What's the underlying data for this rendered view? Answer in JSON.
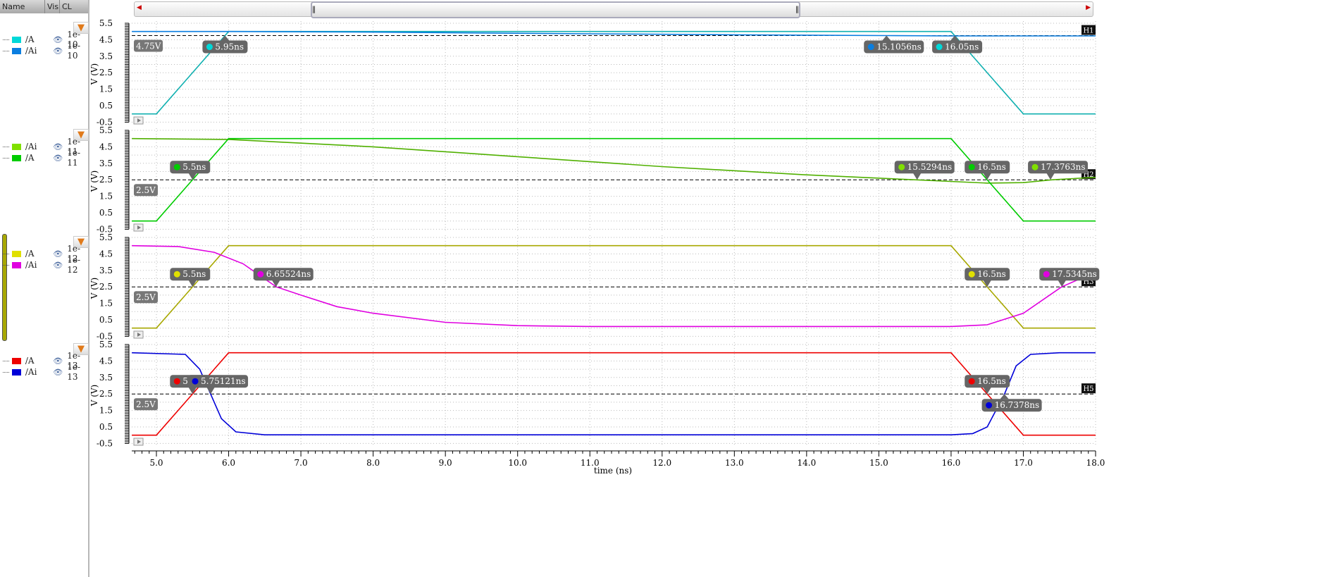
{
  "panel": {
    "headers": {
      "name": "Name",
      "vis": "Vis",
      "cl": "CL"
    },
    "groups": [
      {
        "items": [
          {
            "name": "/A",
            "color": "#00d8d8",
            "cl": "1e-10"
          },
          {
            "name": "/Ai",
            "color": "#0a7ee0",
            "cl": "1e-10"
          }
        ]
      },
      {
        "items": [
          {
            "name": "/Ai",
            "color": "#80e000",
            "cl": "1e-11"
          },
          {
            "name": "/A",
            "color": "#00cc00",
            "cl": "1e-11"
          }
        ]
      },
      {
        "items": [
          {
            "name": "/A",
            "color": "#e0e000",
            "cl": "1e-12"
          },
          {
            "name": "/Ai",
            "color": "#e000e0",
            "cl": "1e-12"
          }
        ]
      },
      {
        "items": [
          {
            "name": "/A",
            "color": "#ee0000",
            "cl": "1e-13"
          },
          {
            "name": "/Ai",
            "color": "#0000d8",
            "cl": "1e-13"
          }
        ]
      }
    ]
  },
  "chart_data": {
    "type": "line",
    "xlabel": "time (ns)",
    "ylabel": "V (V)",
    "xlim": [
      4.66,
      18.0
    ],
    "ylim": [
      -0.5,
      5.5
    ],
    "xticks": [
      "5.0",
      "6.0",
      "7.0",
      "8.0",
      "9.0",
      "10.0",
      "11.0",
      "12.0",
      "13.0",
      "14.0",
      "15.0",
      "16.0",
      "17.0",
      "18.0"
    ],
    "yticks": [
      "5.5",
      "4.5",
      "3.5",
      "2.5",
      "1.5",
      "0.5",
      "-0.5"
    ],
    "grid": true,
    "strips": [
      {
        "series": [
          {
            "name": "/A",
            "color": "#10b0b0",
            "points": [
              [
                4.66,
                0
              ],
              [
                5,
                0
              ],
              [
                6,
                5
              ],
              [
                16,
                5
              ],
              [
                17,
                0
              ],
              [
                18,
                0
              ]
            ]
          },
          {
            "name": "/Ai",
            "color": "#0a7ee0",
            "points": [
              [
                4.66,
                5.0
              ],
              [
                6,
                5.0
              ],
              [
                8,
                4.96
              ],
              [
                11,
                4.86
              ],
              [
                13,
                4.8
              ],
              [
                15.1,
                4.75
              ],
              [
                16,
                4.73
              ],
              [
                18,
                4.73
              ]
            ]
          }
        ],
        "hline": {
          "value": 4.75,
          "label": "4.75V",
          "tag": "H1"
        },
        "markers": [
          {
            "t": 5.95,
            "v": 4.75,
            "label": "5.95ns",
            "color": "#00d8d8",
            "pos": "below"
          },
          {
            "t": 15.1056,
            "v": 4.75,
            "label": "15.1056ns",
            "color": "#0a7ee0",
            "pos": "below"
          },
          {
            "t": 16.05,
            "v": 4.75,
            "label": "16.05ns",
            "color": "#00d8d8",
            "pos": "below"
          }
        ]
      },
      {
        "series": [
          {
            "name": "/Ai",
            "color": "#50b000",
            "points": [
              [
                4.66,
                5
              ],
              [
                6,
                4.95
              ],
              [
                8,
                4.5
              ],
              [
                10,
                3.9
              ],
              [
                12,
                3.3
              ],
              [
                14,
                2.8
              ],
              [
                15.5,
                2.5
              ],
              [
                16.5,
                2.3
              ],
              [
                17,
                2.33
              ],
              [
                17.4,
                2.5
              ],
              [
                18,
                2.65
              ]
            ]
          },
          {
            "name": "/A",
            "color": "#00cc00",
            "points": [
              [
                4.66,
                0
              ],
              [
                5,
                0
              ],
              [
                6,
                5
              ],
              [
                16,
                5
              ],
              [
                17,
                0
              ],
              [
                18,
                0
              ]
            ]
          }
        ],
        "hline": {
          "value": 2.5,
          "label": "2.5V",
          "tag": "H2"
        },
        "markers": [
          {
            "t": 5.5,
            "v": 2.5,
            "label": "5.5ns",
            "color": "#00cc00",
            "pos": "above"
          },
          {
            "t": 15.5294,
            "v": 2.5,
            "label": "15.5294ns",
            "color": "#80e000",
            "pos": "above"
          },
          {
            "t": 16.5,
            "v": 2.5,
            "label": "16.5ns",
            "color": "#00cc00",
            "pos": "above"
          },
          {
            "t": 17.3763,
            "v": 2.5,
            "label": "17.3763ns",
            "color": "#80e000",
            "pos": "above"
          }
        ]
      },
      {
        "series": [
          {
            "name": "/A",
            "color": "#a8a800",
            "points": [
              [
                4.66,
                0
              ],
              [
                5,
                0
              ],
              [
                6,
                5
              ],
              [
                16,
                5
              ],
              [
                17,
                0
              ],
              [
                18,
                0
              ]
            ]
          },
          {
            "name": "/Ai",
            "color": "#e000e0",
            "points": [
              [
                4.66,
                5
              ],
              [
                5.3,
                4.95
              ],
              [
                5.8,
                4.6
              ],
              [
                6.2,
                3.9
              ],
              [
                6.66,
                2.5
              ],
              [
                7,
                2.0
              ],
              [
                7.5,
                1.3
              ],
              [
                8,
                0.9
              ],
              [
                9,
                0.35
              ],
              [
                10,
                0.15
              ],
              [
                11,
                0.1
              ],
              [
                16,
                0.1
              ],
              [
                16.5,
                0.2
              ],
              [
                17,
                0.9
              ],
              [
                17.53,
                2.5
              ],
              [
                18,
                3.4
              ]
            ]
          }
        ],
        "hline": {
          "value": 2.5,
          "label": "2.5V",
          "tag": "H3"
        },
        "markers": [
          {
            "t": 5.5,
            "v": 2.5,
            "label": "5.5ns",
            "color": "#e0e000",
            "pos": "above"
          },
          {
            "t": 6.65524,
            "v": 2.5,
            "label": "6.65524ns",
            "color": "#e000e0",
            "pos": "above"
          },
          {
            "t": 16.5,
            "v": 2.5,
            "label": "16.5ns",
            "color": "#e0e000",
            "pos": "above"
          },
          {
            "t": 17.5345,
            "v": 2.5,
            "label": "17.5345ns",
            "color": "#e000e0",
            "pos": "above"
          }
        ]
      },
      {
        "series": [
          {
            "name": "/A",
            "color": "#ee0000",
            "points": [
              [
                4.66,
                0
              ],
              [
                5,
                0
              ],
              [
                6,
                5
              ],
              [
                16,
                5
              ],
              [
                17,
                0
              ],
              [
                18,
                0
              ]
            ]
          },
          {
            "name": "/Ai",
            "color": "#0000d8",
            "points": [
              [
                4.66,
                5
              ],
              [
                5.4,
                4.9
              ],
              [
                5.6,
                4
              ],
              [
                5.75,
                2.5
              ],
              [
                5.9,
                1
              ],
              [
                6.1,
                0.2
              ],
              [
                6.5,
                0.02
              ],
              [
                16,
                0.02
              ],
              [
                16.3,
                0.1
              ],
              [
                16.5,
                0.5
              ],
              [
                16.74,
                2.5
              ],
              [
                16.9,
                4.2
              ],
              [
                17.1,
                4.9
              ],
              [
                17.5,
                5
              ],
              [
                18,
                5
              ]
            ]
          }
        ],
        "hline": {
          "value": 2.5,
          "label": "2.5V",
          "tag": "H5"
        },
        "markers": [
          {
            "t": 5.5,
            "v": 2.5,
            "label": "5.5ns",
            "color": "#ee0000",
            "pos": "above"
          },
          {
            "t": 5.75121,
            "v": 2.5,
            "label": "5.75121ns",
            "color": "#0000d8",
            "pos": "above"
          },
          {
            "t": 16.5,
            "v": 2.5,
            "label": "16.5ns",
            "color": "#ee0000",
            "pos": "above"
          },
          {
            "t": 16.7378,
            "v": 2.5,
            "label": "16.7378ns",
            "color": "#0000d8",
            "pos": "below"
          }
        ]
      }
    ]
  }
}
